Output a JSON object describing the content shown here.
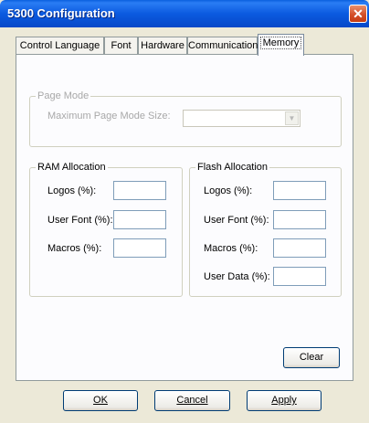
{
  "window": {
    "title": "5300 Configuration",
    "close_glyph": "✕"
  },
  "tabs": [
    {
      "label": "Control Language"
    },
    {
      "label": "Font"
    },
    {
      "label": "Hardware"
    },
    {
      "label": "Communication"
    },
    {
      "label": "Memory",
      "active": true
    }
  ],
  "page_mode": {
    "title": "Page Mode",
    "max_size_label": "Maximum Page Mode Size:",
    "max_size_value": "",
    "arrow_glyph": "▼"
  },
  "ram": {
    "title": "RAM Allocation",
    "fields": [
      {
        "label": "Logos (%):",
        "value": ""
      },
      {
        "label": "User Font (%):",
        "value": ""
      },
      {
        "label": "Macros (%):",
        "value": ""
      }
    ]
  },
  "flash": {
    "title": "Flash Allocation",
    "fields": [
      {
        "label": "Logos (%):",
        "value": ""
      },
      {
        "label": "User Font (%):",
        "value": ""
      },
      {
        "label": "Macros (%):",
        "value": ""
      },
      {
        "label": "User Data (%):",
        "value": ""
      }
    ]
  },
  "buttons": {
    "clear": "Clear",
    "ok": "OK",
    "cancel": "Cancel",
    "apply": "Apply"
  }
}
